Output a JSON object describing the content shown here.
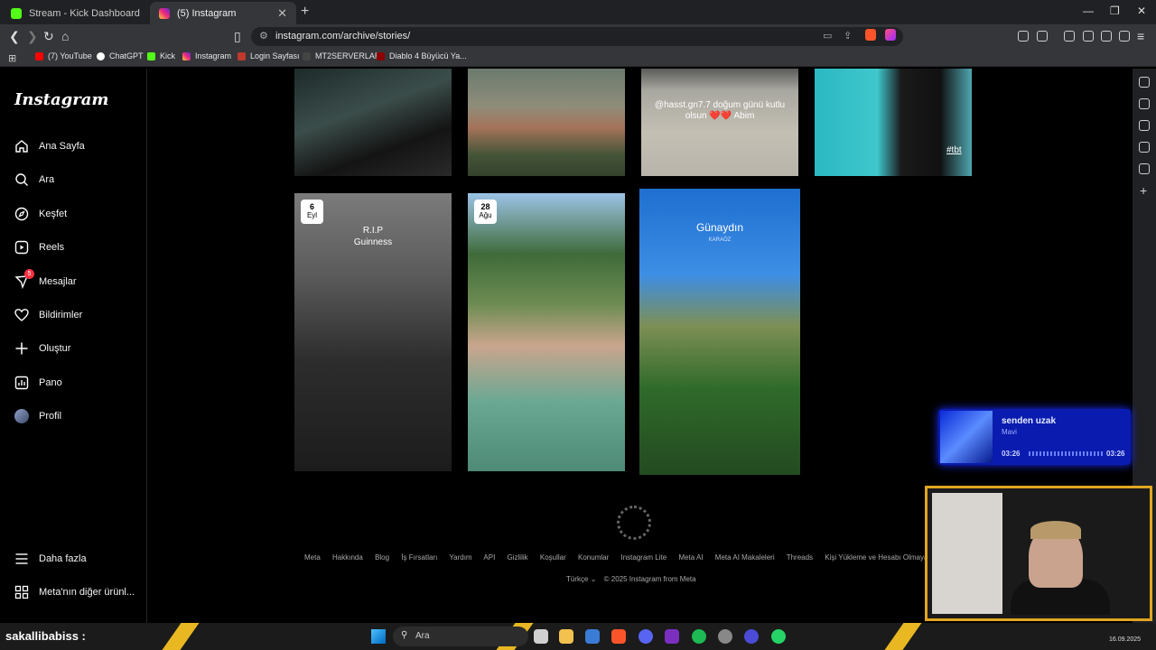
{
  "browser": {
    "tabs": [
      {
        "title": "Stream - Kick Dashboard",
        "active": false,
        "favicon": "kick-icon"
      },
      {
        "title": "(5) Instagram",
        "active": true,
        "favicon": "instagram-icon"
      }
    ],
    "url": "instagram.com/archive/stories/",
    "bookmarks": [
      "(7) YouTube",
      "ChatGPT",
      "Kick",
      "Instagram",
      "Login Sayfası",
      "MT2SERVERLAR",
      "Diablo 4 Büyücü Ya..."
    ]
  },
  "instagram": {
    "logo": "Instagram",
    "nav": [
      {
        "label": "Ana Sayfa",
        "icon": "home-icon"
      },
      {
        "label": "Ara",
        "icon": "search-icon"
      },
      {
        "label": "Keşfet",
        "icon": "compass-icon"
      },
      {
        "label": "Reels",
        "icon": "reels-icon"
      },
      {
        "label": "Mesajlar",
        "icon": "messenger-icon",
        "badge": "5"
      },
      {
        "label": "Bildirimler",
        "icon": "heart-icon"
      },
      {
        "label": "Oluştur",
        "icon": "plus-icon"
      },
      {
        "label": "Pano",
        "icon": "dashboard-icon"
      },
      {
        "label": "Profil",
        "icon": "avatar-icon"
      }
    ],
    "bottom_nav": [
      {
        "label": "Daha fazla",
        "icon": "menu-icon"
      },
      {
        "label": "Meta'nın diğer ürünl...",
        "icon": "meta-apps-icon"
      }
    ],
    "stories": [
      {
        "overlay": ""
      },
      {
        "overlay": ""
      },
      {
        "overlay": "@hasst.gn7.7 doğum günü kutlu olsun ❤️❤️ Abim"
      },
      {
        "overlay": "#tbt"
      },
      {
        "date_day": "6",
        "date_month": "Eyl",
        "overlay": "R.I.P Guinness"
      },
      {
        "date_day": "28",
        "date_month": "Ağu",
        "overlay": ""
      },
      {
        "overlay": "Günaydın",
        "location": "KARAÖZ"
      }
    ],
    "footer": {
      "links": [
        "Meta",
        "Hakkında",
        "Blog",
        "İş Fırsatları",
        "Yardım",
        "API",
        "Gizlilik",
        "Koşullar",
        "Konumlar",
        "Instagram Lite",
        "Meta AI",
        "Meta AI Makaleleri",
        "Threads",
        "Kişi Yükleme ve Hesabı Olmayan Kişiler"
      ],
      "language": "Türkçe",
      "copyright": "© 2025 Instagram from Meta"
    }
  },
  "overlay": {
    "song": "senden uzak",
    "artist": "Mavi",
    "time_start": "03:26",
    "time_end": "03:26",
    "streamer": "sakallibabiss :"
  },
  "taskbar": {
    "search_placeholder": "Ara",
    "date": "16.09.2025"
  }
}
